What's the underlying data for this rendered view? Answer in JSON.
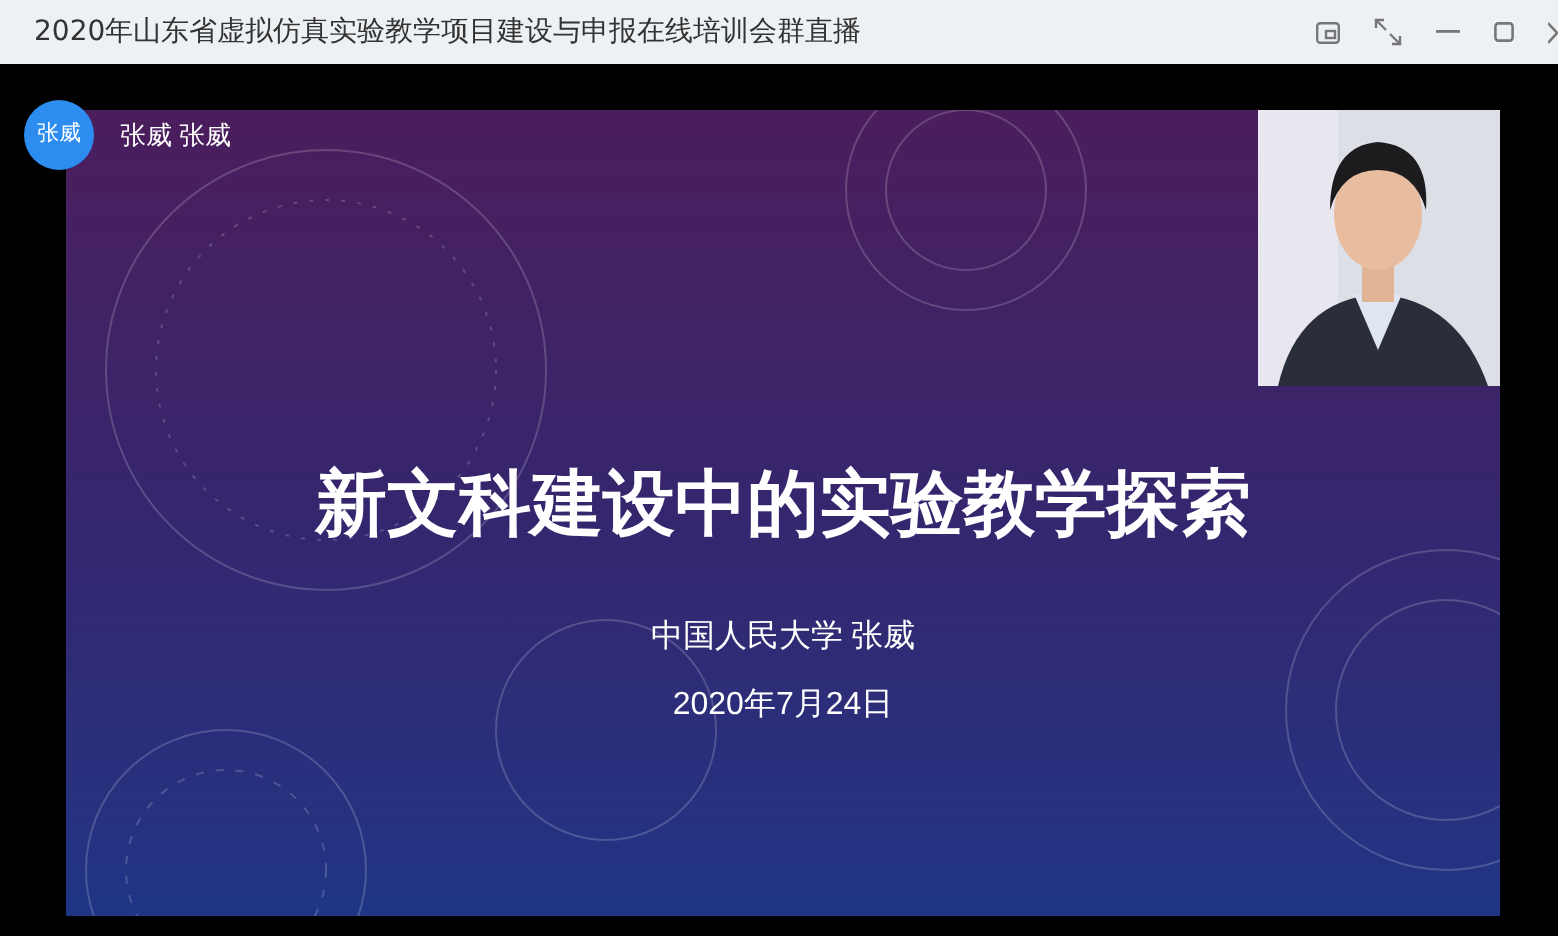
{
  "window": {
    "title": "2020年山东省虚拟仿真实验教学项目建设与申报在线培训会群直播"
  },
  "presenter": {
    "avatar_text": "张威",
    "name": "张威 张威"
  },
  "slide": {
    "title": "新文科建设中的实验教学探索",
    "subtitle": "中国人民大学 张威",
    "date": "2020年7月24日"
  }
}
